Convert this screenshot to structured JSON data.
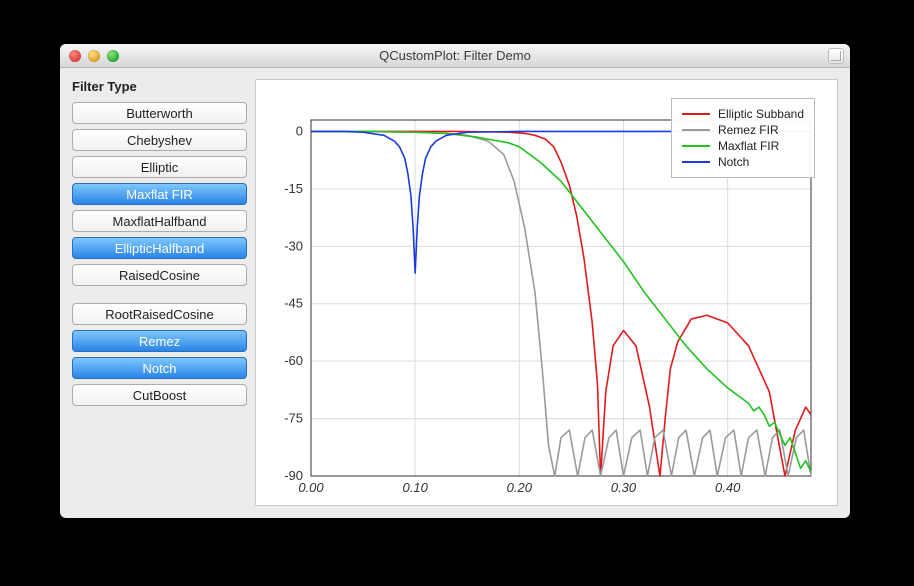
{
  "window": {
    "title": "QCustomPlot: Filter Demo"
  },
  "side": {
    "heading": "Filter Type",
    "buttons": [
      {
        "id": "butterworth",
        "label": "Butterworth",
        "selected": false
      },
      {
        "id": "chebyshev",
        "label": "Chebyshev",
        "selected": false
      },
      {
        "id": "elliptic",
        "label": "Elliptic",
        "selected": false
      },
      {
        "id": "maxflatfir",
        "label": "Maxflat FIR",
        "selected": true
      },
      {
        "id": "maxflathalfband",
        "label": "MaxflatHalfband",
        "selected": false
      },
      {
        "id": "elliptichalfband",
        "label": "EllipticHalfband",
        "selected": true
      },
      {
        "id": "raisedcosine",
        "label": "RaisedCosine",
        "selected": false
      }
    ],
    "buttons2": [
      {
        "id": "rootraisedcosine",
        "label": "RootRaisedCosine",
        "selected": false
      },
      {
        "id": "remez",
        "label": "Remez",
        "selected": true
      },
      {
        "id": "notch",
        "label": "Notch",
        "selected": true
      },
      {
        "id": "cutboost",
        "label": "CutBoost",
        "selected": false
      }
    ]
  },
  "legend": [
    {
      "name": "Elliptic Subband",
      "color": "#e31a1c"
    },
    {
      "name": "Remez FIR",
      "color": "#9a9a9a"
    },
    {
      "name": "Maxflat FIR",
      "color": "#1fc41f"
    },
    {
      "name": "Notch",
      "color": "#1a3ae0"
    }
  ],
  "chart_data": {
    "type": "line",
    "xlabel": "",
    "ylabel": "",
    "xlim": [
      0.0,
      0.48
    ],
    "ylim": [
      -90,
      3
    ],
    "xticks": [
      0.0,
      0.1,
      0.2,
      0.3,
      0.4
    ],
    "yticks": [
      0,
      -15,
      -30,
      -45,
      -60,
      -75,
      -90
    ],
    "series": [
      {
        "name": "Elliptic Subband",
        "color": "#e31a1c",
        "x": [
          0.0,
          0.05,
          0.1,
          0.14,
          0.17,
          0.19,
          0.205,
          0.215,
          0.225,
          0.233,
          0.24,
          0.248,
          0.255,
          0.262,
          0.27,
          0.275,
          0.278,
          0.283,
          0.29,
          0.3,
          0.312,
          0.325,
          0.335,
          0.34,
          0.345,
          0.352,
          0.365,
          0.38,
          0.4,
          0.42,
          0.44,
          0.455,
          0.465,
          0.475,
          0.48
        ],
        "y": [
          0,
          0,
          0,
          0,
          -0.1,
          -0.2,
          -0.5,
          -1,
          -2,
          -4,
          -8,
          -14,
          -22,
          -33,
          -50,
          -66,
          -90,
          -68,
          -56,
          -52,
          -56,
          -72,
          -90,
          -75,
          -62,
          -55,
          -49,
          -48,
          -50,
          -56,
          -68,
          -90,
          -78,
          -72,
          -74
        ]
      },
      {
        "name": "Remez FIR",
        "color": "#9a9a9a",
        "x": [
          0.0,
          0.05,
          0.1,
          0.13,
          0.15,
          0.17,
          0.185,
          0.195,
          0.205,
          0.215,
          0.222,
          0.228,
          0.234,
          0.24,
          0.248,
          0.256,
          0.263,
          0.27,
          0.278,
          0.286,
          0.293,
          0.3,
          0.308,
          0.316,
          0.323,
          0.33,
          0.338,
          0.346,
          0.353,
          0.36,
          0.368,
          0.376,
          0.383,
          0.39,
          0.398,
          0.406,
          0.413,
          0.42,
          0.428,
          0.436,
          0.443,
          0.45,
          0.458,
          0.466,
          0.473,
          0.48
        ],
        "y": [
          0,
          0,
          -0.2,
          -0.5,
          -1,
          -2.5,
          -6,
          -13,
          -25,
          -42,
          -62,
          -82,
          -90,
          -80,
          -78,
          -90,
          -80,
          -78,
          -90,
          -80,
          -78,
          -90,
          -80,
          -78,
          -90,
          -80,
          -78,
          -90,
          -80,
          -78,
          -90,
          -80,
          -78,
          -90,
          -80,
          -78,
          -90,
          -80,
          -78,
          -90,
          -80,
          -78,
          -90,
          -80,
          -78,
          -90
        ]
      },
      {
        "name": "Maxflat FIR",
        "color": "#1fc41f",
        "x": [
          0.0,
          0.05,
          0.1,
          0.13,
          0.16,
          0.19,
          0.2,
          0.22,
          0.24,
          0.26,
          0.28,
          0.3,
          0.32,
          0.34,
          0.36,
          0.38,
          0.4,
          0.41,
          0.42,
          0.425,
          0.43,
          0.435,
          0.44,
          0.445,
          0.45,
          0.455,
          0.46,
          0.465,
          0.47,
          0.475,
          0.48
        ],
        "y": [
          0,
          0,
          -0.2,
          -0.5,
          -1.5,
          -3,
          -4,
          -8,
          -13,
          -20,
          -27,
          -34,
          -42,
          -49,
          -56,
          -62,
          -67,
          -69,
          -71,
          -73,
          -72,
          -74,
          -77,
          -76,
          -79,
          -82,
          -80,
          -84,
          -88,
          -86,
          -89
        ]
      },
      {
        "name": "Notch",
        "color": "#1a3ae0",
        "x": [
          0.0,
          0.03,
          0.05,
          0.07,
          0.08,
          0.085,
          0.09,
          0.093,
          0.096,
          0.098,
          0.1,
          0.102,
          0.104,
          0.107,
          0.11,
          0.115,
          0.12,
          0.13,
          0.15,
          0.2,
          0.3,
          0.4,
          0.48
        ],
        "y": [
          0,
          0,
          -0.2,
          -1,
          -2.5,
          -4,
          -7,
          -11,
          -17,
          -25,
          -37,
          -25,
          -17,
          -11,
          -7,
          -4,
          -2.5,
          -1,
          -0.2,
          0,
          0,
          0,
          0
        ]
      }
    ]
  }
}
